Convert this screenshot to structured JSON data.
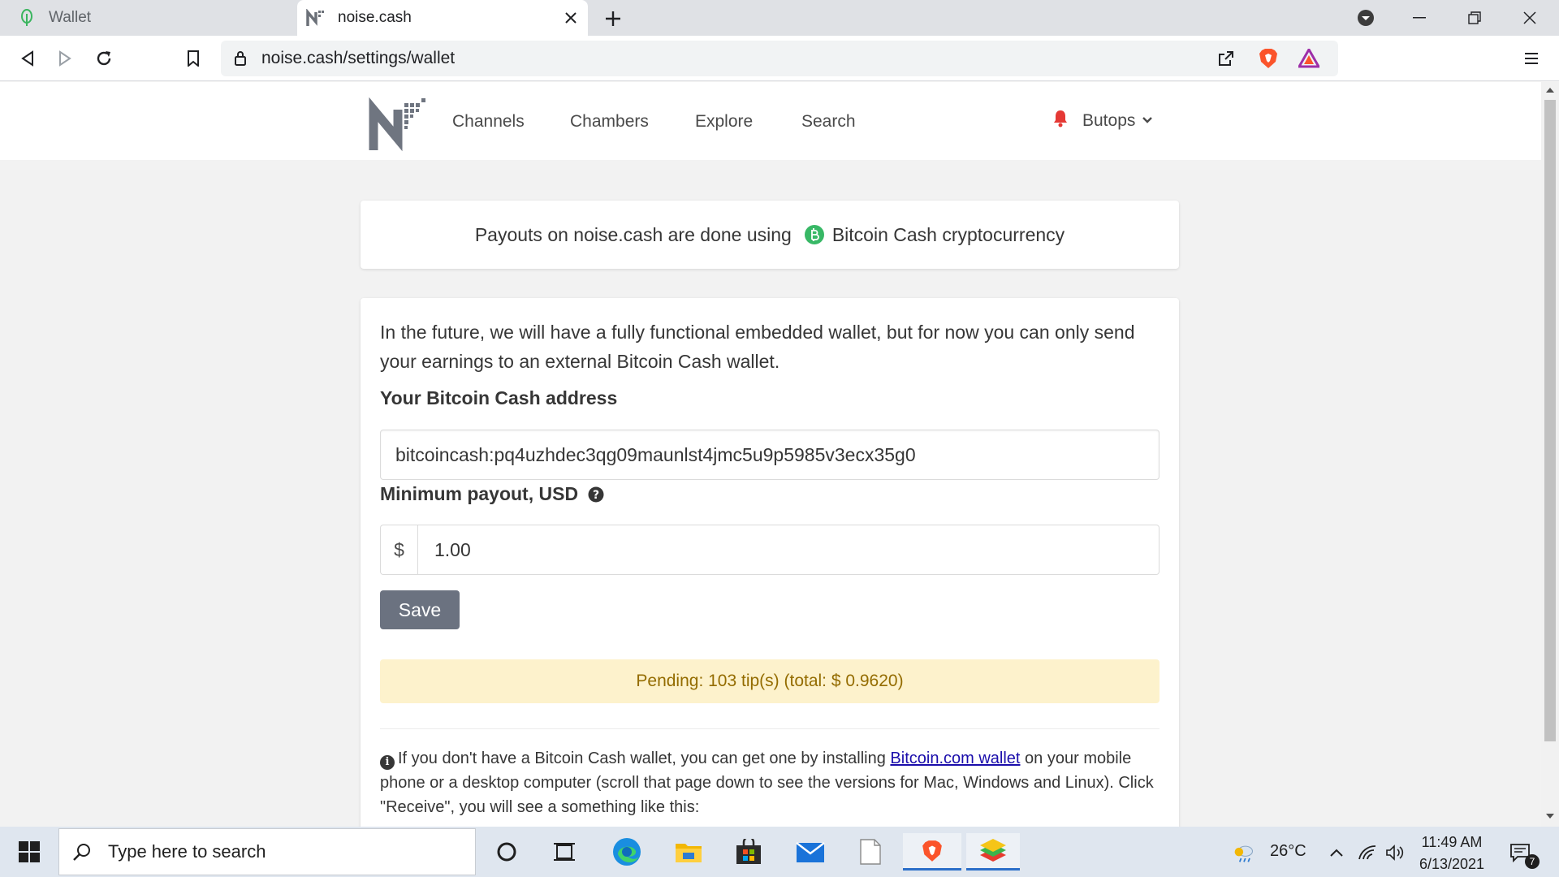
{
  "browser": {
    "tabs": [
      {
        "label": "Wallet",
        "active": false
      },
      {
        "label": "noise.cash",
        "active": true
      }
    ],
    "url": "noise.cash/settings/wallet"
  },
  "site": {
    "nav": [
      "Channels",
      "Chambers",
      "Explore",
      "Search"
    ],
    "user": "Butops"
  },
  "notice": {
    "prefix": "Payouts on noise.cash are done using",
    "currency": "Bitcoin Cash cryptocurrency"
  },
  "wallet": {
    "intro": "In the future, we will have a fully functional embedded wallet, but for now you can only send your earnings to an external Bitcoin Cash wallet.",
    "address_label": "Your Bitcoin Cash address",
    "address_value": "bitcoincash:pq4uzhdec3qg09maunlst4jmc5u9p5985v3ecx35g0",
    "payout_label": "Minimum payout, USD",
    "currency_symbol": "$",
    "payout_value": "1.00",
    "save_label": "Save",
    "pending": "Pending: 103 tip(s) (total: $ 0.9620)",
    "help_before": "If you don't have a Bitcoin Cash wallet, you can get one by installing",
    "help_link": "Bitcoin.com wallet",
    "help_after": "on your mobile phone or a desktop computer (scroll that page down to see the versions for Mac, Windows and Linux). Click \"Receive\", you will see a something like this:"
  },
  "taskbar": {
    "search_placeholder": "Type here to search",
    "temperature": "26°C",
    "time": "11:49 AM",
    "date": "6/13/2021",
    "notification_count": "7"
  },
  "colors": {
    "bch_green": "#38b866",
    "save_button": "#6b7280",
    "pending_bg": "#fdf2cc",
    "pending_text": "#946c00",
    "bell_red": "#e53935",
    "brave_orange": "#fb542b"
  }
}
